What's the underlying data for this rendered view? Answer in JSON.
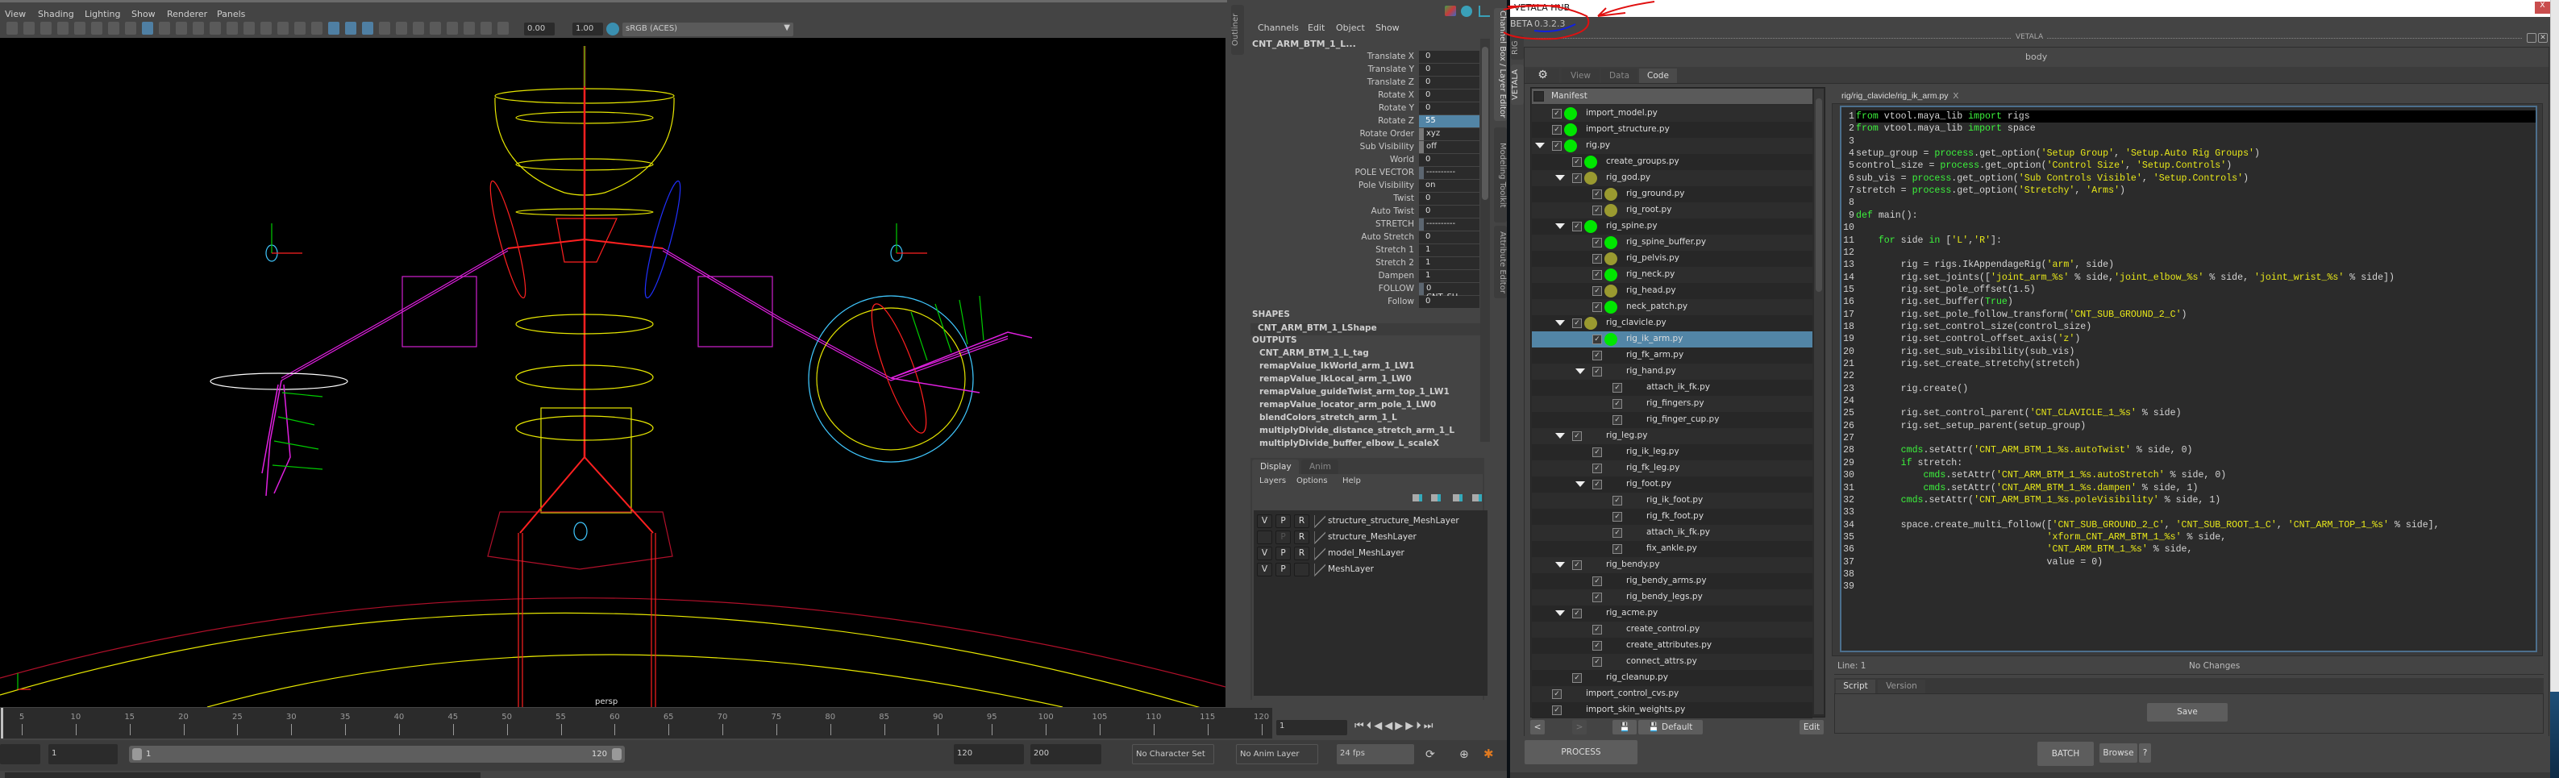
{
  "viewport": {
    "menu": [
      "View",
      "Shading",
      "Lighting",
      "Show",
      "Renderer",
      "Panels"
    ],
    "exposure": "0.00",
    "gamma": "1.00",
    "color_space": "sRGB (ACES)",
    "camera_label": "persp",
    "outliner_tab": "Outliner"
  },
  "channel_box": {
    "menu": [
      "Channels",
      "Edit",
      "Object",
      "Show"
    ],
    "object": "CNT_ARM_BTM_1_L...",
    "channels": [
      {
        "label": "Translate X",
        "value": "0"
      },
      {
        "label": "Translate Y",
        "value": "0"
      },
      {
        "label": "Translate Z",
        "value": "0"
      },
      {
        "label": "Rotate X",
        "value": "0"
      },
      {
        "label": "Rotate Y",
        "value": "0"
      },
      {
        "label": "Rotate Z",
        "value": "55",
        "selected": true
      },
      {
        "label": "Rotate Order",
        "value": "xyz",
        "kind": "lk"
      },
      {
        "label": "Sub Visibility",
        "value": "off",
        "kind": "lk"
      },
      {
        "label": "World",
        "value": "0"
      },
      {
        "label": "POLE VECTOR",
        "value": "----------",
        "kind": "sep"
      },
      {
        "label": "Pole Visibility",
        "value": "on"
      },
      {
        "label": "Twist",
        "value": "0"
      },
      {
        "label": "Auto Twist",
        "value": "0"
      },
      {
        "label": "STRETCH",
        "value": "----------",
        "kind": "sep"
      },
      {
        "label": "Auto Stretch",
        "value": "0"
      },
      {
        "label": "Stretch 1",
        "value": "1"
      },
      {
        "label": "Stretch 2",
        "value": "1"
      },
      {
        "label": "Dampen",
        "value": "1"
      },
      {
        "label": "FOLLOW",
        "value": "0 CNT_SU...",
        "kind": "sep"
      },
      {
        "label": "Follow",
        "value": "0"
      }
    ],
    "shapes_header": "SHAPES",
    "shape": "CNT_ARM_BTM_1_LShape",
    "outputs_header": "OUTPUTS",
    "outputs": [
      "CNT_ARM_BTM_1_L_tag",
      "remapValue_IkWorld_arm_1_LW1",
      "remapValue_IkLocal_arm_1_LW0",
      "remapValue_guideTwist_arm_top_1_LW1",
      "remapValue_locator_arm_pole_1_LW0",
      "blendColors_stretch_arm_1_L",
      "multiplyDivide_distance_stretch_arm_1_L",
      "multiplyDivide_buffer_elbow_L_scaleX"
    ]
  },
  "layer_editor": {
    "tabs": [
      "Display",
      "Anim"
    ],
    "menu": [
      "Layers",
      "Options",
      "Help"
    ],
    "layers": [
      {
        "v": "V",
        "p": "P",
        "r": "R",
        "name": "structure_structure_MeshLayer"
      },
      {
        "v": "",
        "p": "P",
        "r": "R",
        "name": "structure_MeshLayer",
        "p_dim": true
      },
      {
        "v": "V",
        "p": "P",
        "r": "R",
        "name": "model_MeshLayer"
      },
      {
        "v": "V",
        "p": "P",
        "r": "",
        "name": "MeshLayer"
      }
    ]
  },
  "side_tabs": [
    "Channel Box / Layer Editor",
    "Modeling Toolkit",
    "Attribute Editor"
  ],
  "timeline": {
    "start": 1,
    "end": 120,
    "label_step": 5,
    "current_frame": "1",
    "range_start": "1",
    "range_inner_start": "1",
    "range_inner_end": "120",
    "range_end": "120",
    "anim_end": "200",
    "character_set": "No Character Set",
    "anim_layer": "No Anim Layer",
    "fps": "24 fps"
  },
  "vetala": {
    "window_title": "VETALA HUB",
    "beta_label": "BETA",
    "version": "0.3.2.3",
    "side_tabs": [
      "RIG",
      "VETALA"
    ],
    "dock_title": "VETALA",
    "project": "body",
    "tabs": [
      "View",
      "Data",
      "Code"
    ],
    "active_tab": "Code",
    "manifest_label": "Manifest",
    "tree": [
      {
        "label": "import_model.py",
        "level": 0,
        "status": "green"
      },
      {
        "label": "import_structure.py",
        "level": 0,
        "status": "green"
      },
      {
        "label": "rig.py",
        "level": 0,
        "status": "green",
        "expanded": true
      },
      {
        "label": "create_groups.py",
        "level": 1,
        "status": "green"
      },
      {
        "label": "rig_god.py",
        "level": 1,
        "status": "olive",
        "expanded": true
      },
      {
        "label": "rig_ground.py",
        "level": 2,
        "status": "olive"
      },
      {
        "label": "rig_root.py",
        "level": 2,
        "status": "olive"
      },
      {
        "label": "rig_spine.py",
        "level": 1,
        "status": "green",
        "expanded": true
      },
      {
        "label": "rig_spine_buffer.py",
        "level": 2,
        "status": "green"
      },
      {
        "label": "rig_pelvis.py",
        "level": 2,
        "status": "olive"
      },
      {
        "label": "rig_neck.py",
        "level": 2,
        "status": "green"
      },
      {
        "label": "rig_head.py",
        "level": 2,
        "status": "olive"
      },
      {
        "label": "neck_patch.py",
        "level": 2,
        "status": "green"
      },
      {
        "label": "rig_clavicle.py",
        "level": 1,
        "status": "olive",
        "expanded": true
      },
      {
        "label": "rig_ik_arm.py",
        "level": 2,
        "status": "green",
        "selected": true
      },
      {
        "label": "rig_fk_arm.py",
        "level": 2
      },
      {
        "label": "rig_hand.py",
        "level": 2,
        "expanded": true
      },
      {
        "label": "attach_ik_fk.py",
        "level": 3
      },
      {
        "label": "rig_fingers.py",
        "level": 3
      },
      {
        "label": "rig_finger_cup.py",
        "level": 3
      },
      {
        "label": "rig_leg.py",
        "level": 1,
        "expanded": true
      },
      {
        "label": "rig_ik_leg.py",
        "level": 2
      },
      {
        "label": "rig_fk_leg.py",
        "level": 2
      },
      {
        "label": "rig_foot.py",
        "level": 2,
        "expanded": true
      },
      {
        "label": "rig_ik_foot.py",
        "level": 3
      },
      {
        "label": "rig_fk_foot.py",
        "level": 3
      },
      {
        "label": "attach_ik_fk.py",
        "level": 3
      },
      {
        "label": "fix_ankle.py",
        "level": 3
      },
      {
        "label": "rig_bendy.py",
        "level": 1,
        "expanded": true
      },
      {
        "label": "rig_bendy_arms.py",
        "level": 2
      },
      {
        "label": "rig_bendy_legs.py",
        "level": 2
      },
      {
        "label": "rig_acme.py",
        "level": 1,
        "expanded": true
      },
      {
        "label": "create_control.py",
        "level": 2
      },
      {
        "label": "create_attributes.py",
        "level": 2
      },
      {
        "label": "connect_attrs.py",
        "level": 2
      },
      {
        "label": "rig_cleanup.py",
        "level": 1
      },
      {
        "label": "import_control_cvs.py",
        "level": 0
      },
      {
        "label": "import_skin_weights.py",
        "level": 0
      }
    ],
    "tree_buttons": {
      "back": "<",
      "forward": ">",
      "default": "Default",
      "edit": "Edit"
    },
    "code_tab": "rig/rig_clavicle/rig_ik_arm.py",
    "code_tab_close": "X",
    "code_lines": [
      "from vtool.maya_lib import rigs",
      "from vtool.maya_lib import space",
      "",
      "setup_group = process.get_option('Setup Group', 'Setup.Auto Rig Groups')",
      "control_size = process.get_option('Control Size', 'Setup.Controls')",
      "sub_vis = process.get_option('Sub Controls Visible', 'Setup.Controls')",
      "stretch = process.get_option('Stretchy', 'Arms')",
      "",
      "def main():",
      "",
      "    for side in ['L','R']:",
      "",
      "        rig = rigs.IkAppendageRig('arm', side)",
      "        rig.set_joints(['joint_arm_%s' % side,'joint_elbow_%s' % side, 'joint_wrist_%s' % side])",
      "        rig.set_pole_offset(1.5)",
      "        rig.set_buffer(True)",
      "        rig.set_pole_follow_transform('CNT_SUB_GROUND_2_C')",
      "        rig.set_control_size(control_size)",
      "        rig.set_control_offset_axis('z')",
      "        rig.set_sub_visibility(sub_vis)",
      "        rig.set_create_stretchy(stretch)",
      "",
      "        rig.create()",
      "",
      "        rig.set_control_parent('CNT_CLAVICLE_1_%s' % side)",
      "        rig.set_setup_parent(setup_group)",
      "",
      "        cmds.setAttr('CNT_ARM_BTM_1_%s.autoTwist' % side, 0)",
      "        if stretch:",
      "            cmds.setAttr('CNT_ARM_BTM_1_%s.autoStretch' % side, 0)",
      "            cmds.setAttr('CNT_ARM_BTM_1_%s.dampen' % side, 1)",
      "        cmds.setAttr('CNT_ARM_BTM_1_%s.poleVisibility' % side, 1)",
      "",
      "        space.create_multi_follow(['CNT_SUB_GROUND_2_C', 'CNT_SUB_ROOT_1_C', 'CNT_ARM_TOP_1_%s' % side],",
      "                                  'xform_CNT_ARM_BTM_1_%s' % side,",
      "                                  'CNT_ARM_BTM_1_%s' % side,",
      "                                  value = 0)",
      "",
      ""
    ],
    "status_line": "Line: 1",
    "status_changes": "No Changes",
    "bottom_tabs": [
      "Script",
      "Version"
    ],
    "save_label": "Save",
    "process_label": "PROCESS",
    "batch_label": "BATCH",
    "browse_label": "Browse",
    "help_label": "?",
    "close_label": "X"
  },
  "colors": {
    "selection": "#5285a6",
    "status_green": "#00e600",
    "status_olive": "#9a9a30",
    "annotation_red": "#e01010",
    "annotation_blue": "#1020e0"
  }
}
